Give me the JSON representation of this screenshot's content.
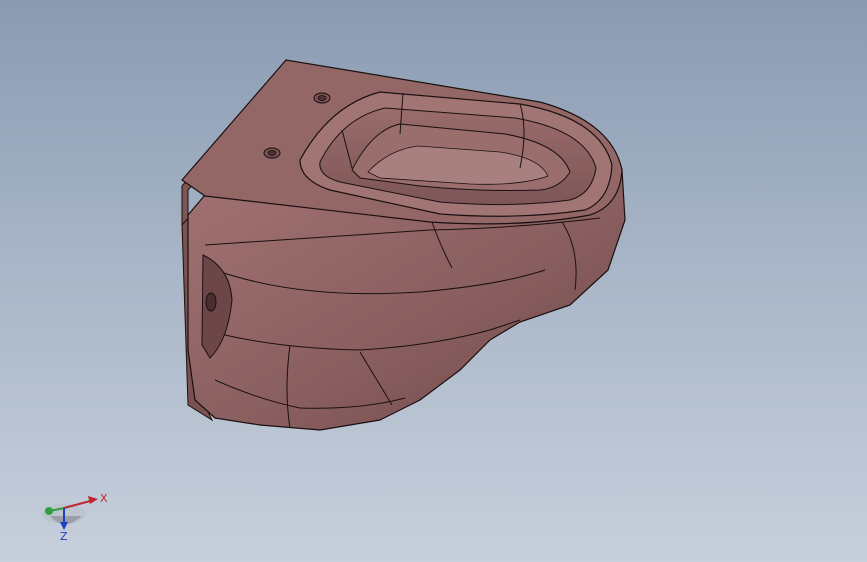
{
  "viewport": {
    "background_top": "#8a9bb2",
    "background_bottom": "#c7cfdc"
  },
  "model": {
    "body_color": "#8c6464",
    "edge_color": "#1a1010",
    "highlight_color": "#b07f7f"
  },
  "triad": {
    "x_label": "X",
    "z_label": "Z",
    "x_color": "#c0272d",
    "y_color": "#2ea043",
    "z_color": "#1f3fbf"
  }
}
